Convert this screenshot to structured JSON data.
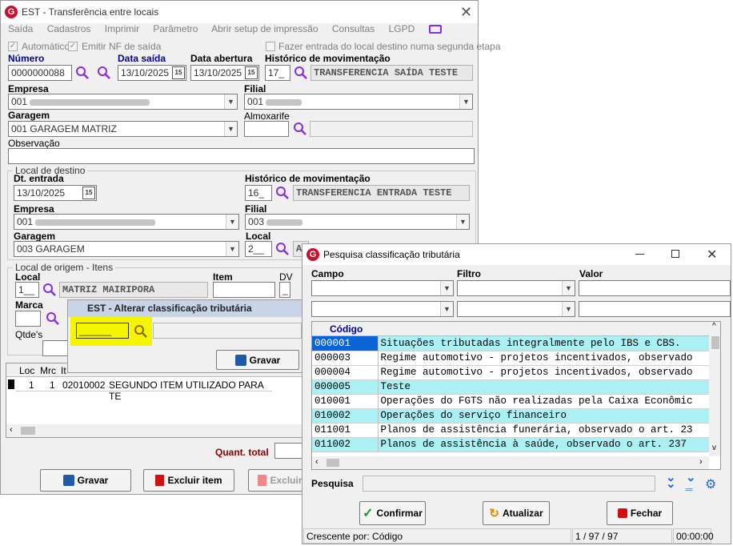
{
  "main_window": {
    "title": "EST - Transferência entre locais",
    "menu": [
      "Saída",
      "Cadastros",
      "Imprimir",
      "Parâmetro",
      "Abrir setup de impressão",
      "Consultas",
      "LGPD"
    ],
    "chk_automatico": "Automático",
    "chk_emitir_nf": "Emitir NF de saída",
    "chk_fazer_entrada": "Fazer entrada do local destino numa segunda etapa",
    "numero_label": "Número",
    "numero_value": "0000000088",
    "data_saida_label": "Data saída",
    "data_saida_value": "13/10/2025",
    "data_abertura_label": "Data abertura",
    "data_abertura_value": "13/10/2025",
    "cal_icon_text": "15",
    "historico_label": "Histórico de movimentação",
    "historico_code": "17_",
    "historico_desc": "TRANSFERENCIA SAÍDA TESTE",
    "empresa_label": "Empresa",
    "empresa_value": "001",
    "filial_label": "Filial",
    "filial_value": "001",
    "garagem_label": "Garagem",
    "garagem_value": "001 GARAGEM MATRIZ",
    "almoxarife_label": "Almoxarife",
    "observacao_label": "Observação",
    "destino": {
      "group_title": "Local de destino",
      "dt_entrada_label": "Dt. entrada",
      "dt_entrada_value": "13/10/2025",
      "historico_label": "Histórico de movimentação",
      "historico_code": "16_",
      "historico_desc": "TRANSFERENCIA ENTRADA TESTE",
      "empresa_label": "Empresa",
      "empresa_value": "001",
      "filial_label": "Filial",
      "filial_value": "003",
      "garagem_label": "Garagem",
      "garagem_value": "003 GARAGEM",
      "local_label": "Local",
      "local_code": "2__",
      "local_desc": "A"
    },
    "origem": {
      "group_title": "Local de origem - Itens",
      "local_label": "Local",
      "local_code": "1__",
      "local_desc": "MATRIZ MAIRIPORA",
      "item_label": "Item",
      "dv_label": "DV",
      "dv_value": "_",
      "marca_label": "Marca",
      "qtde_label": "Qtde's"
    },
    "items_grid": {
      "headers": [
        "Loc",
        "Mrc",
        "It"
      ],
      "row": {
        "loc": "1",
        "mrc": "1",
        "item": "02010002",
        "desc": "SEGUNDO ITEM UTILIZADO PARA TE"
      }
    },
    "quant_total_label": "Quant. total",
    "btn_gravar": "Gravar",
    "btn_excluir_item": "Excluir item",
    "btn_excluir": "Excluir"
  },
  "alterar_dialog": {
    "title": "EST - Alterar classificação tributária",
    "code_value": "______",
    "btn_gravar": "Gravar"
  },
  "pesquisa_window": {
    "title": "Pesquisa classificação tributária",
    "campo_label": "Campo",
    "filtro_label": "Filtro",
    "valor_label": "Valor",
    "col_codigo": "Código",
    "rows": [
      {
        "code": "000001",
        "desc": "Situações tributadas integralmente pelo IBS e CBS."
      },
      {
        "code": "000003",
        "desc": "Regime automotivo - projetos incentivados, observado"
      },
      {
        "code": "000004",
        "desc": "Regime automotivo - projetos incentivados, observado"
      },
      {
        "code": "000005",
        "desc": "Teste"
      },
      {
        "code": "010001",
        "desc": "Operações do FGTS não realizadas pela Caixa Econômic"
      },
      {
        "code": "010002",
        "desc": "Operações do serviço financeiro"
      },
      {
        "code": "011001",
        "desc": "Planos de assistência funerária, observado o art. 23"
      },
      {
        "code": "011002",
        "desc": "Planos de assistência à saúde, observado o art. 237"
      }
    ],
    "pesquisa_label": "Pesquisa",
    "btn_confirmar": "Confirmar",
    "btn_atualizar": "Atualizar",
    "btn_fechar": "Fechar",
    "status_order": "Crescente por: Código",
    "status_count": "1 / 97 / 97",
    "status_time": "00:00:00"
  },
  "colors": {
    "label_blue": "#0000a0",
    "grid_cyan": "#aaf0f4",
    "selection_blue": "#0a64d8",
    "highlight_yellow": "#f5f500",
    "search_purple": "#8a2be2"
  }
}
